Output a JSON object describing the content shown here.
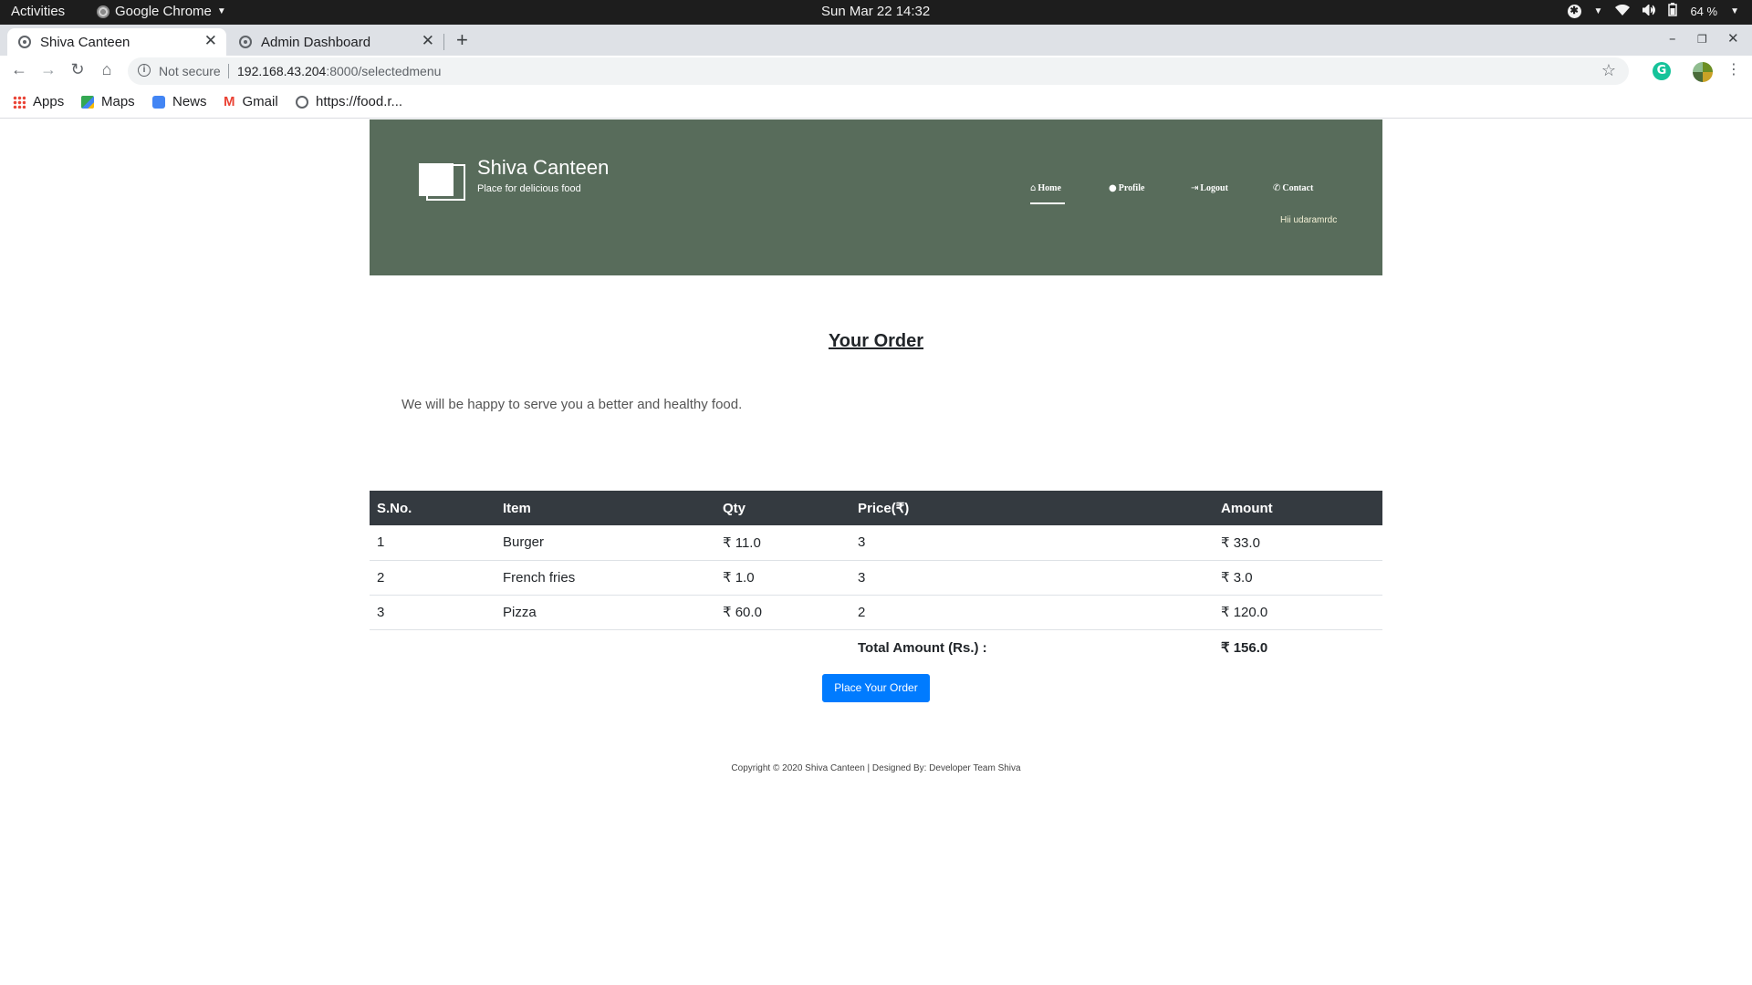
{
  "os_bar": {
    "activities": "Activities",
    "app_name": "Google Chrome",
    "clock": "Sun Mar 22  14:32",
    "battery": "64 %"
  },
  "browser": {
    "tabs": [
      {
        "title": "Shiva Canteen",
        "active": true
      },
      {
        "title": "Admin Dashboard",
        "active": false
      }
    ],
    "not_secure": "Not secure",
    "url_host": "192.168.43.204",
    "url_path": ":8000/selectedmenu",
    "bookmarks": [
      "Apps",
      "Maps",
      "News",
      "Gmail",
      "https://food.r..."
    ]
  },
  "header": {
    "title": "Shiva Canteen",
    "tagline": "Place for delicious food",
    "nav": [
      "Home",
      "Profile",
      "Logout",
      "Contact"
    ],
    "greeting": "Hii udaramrdc",
    "bg_color": "#586c5b"
  },
  "order": {
    "title": "Your Order",
    "subtitle": "We will be happy to serve you a better and healthy food.",
    "columns": [
      "S.No.",
      "Item",
      "Qty",
      "Price(₹)",
      "Amount"
    ],
    "rows": [
      [
        "1",
        "Burger",
        "₹ 11.0",
        "3",
        "₹ 33.0"
      ],
      [
        "2",
        "French fries",
        "₹ 1.0",
        "3",
        "₹ 3.0"
      ],
      [
        "3",
        "Pizza",
        "₹ 60.0",
        "2",
        "₹ 120.0"
      ]
    ],
    "total_label": "Total Amount (Rs.) :",
    "total_value": "₹ 156.0",
    "button": "Place Your Order"
  },
  "footer": "Copyright © 2020 Shiva Canteen | Designed By: Developer Team Shiva"
}
